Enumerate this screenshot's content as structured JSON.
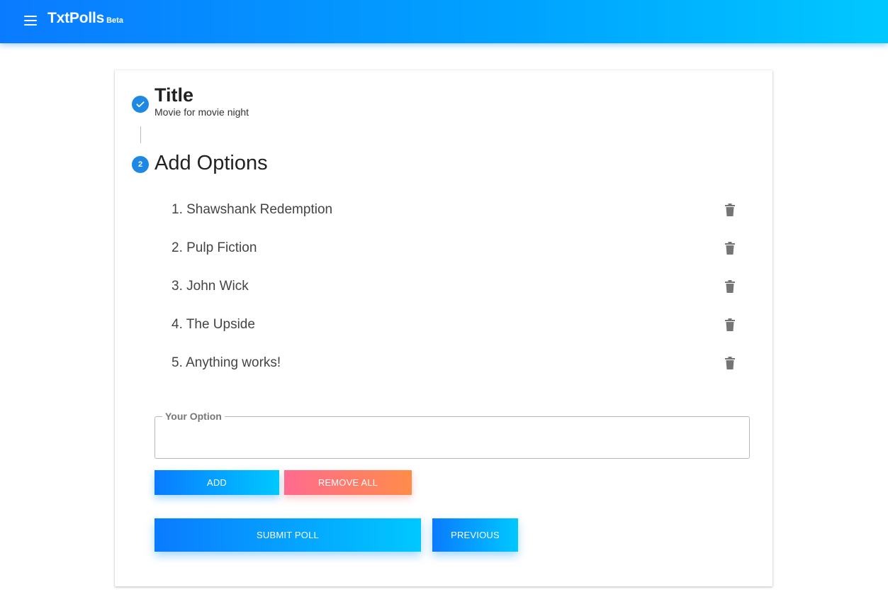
{
  "app": {
    "name": "TxtPolls",
    "badge": "Beta",
    "icons": {
      "menu": "menu-icon",
      "check": "check-icon",
      "delete": "trash-icon"
    },
    "colors": {
      "primary": "#1e88e5",
      "gradient_start": "#0a7bff",
      "gradient_end": "#00c8ff",
      "danger_start": "#ff6b8f",
      "danger_end": "#ff8c4a"
    }
  },
  "stepper": {
    "step1": {
      "title": "Title",
      "value": "Movie for movie night"
    },
    "step2": {
      "number": "2",
      "title": "Add Options"
    }
  },
  "options": [
    {
      "label": "1. Shawshank Redemption"
    },
    {
      "label": "2. Pulp Fiction"
    },
    {
      "label": "3. John Wick"
    },
    {
      "label": "4. The Upside"
    },
    {
      "label": "5. Anything works!"
    }
  ],
  "input": {
    "label": "Your Option",
    "value": ""
  },
  "buttons": {
    "add": "ADD",
    "remove_all": "REMOVE ALL",
    "submit": "SUBMIT POLL",
    "previous": "PREVIOUS"
  }
}
